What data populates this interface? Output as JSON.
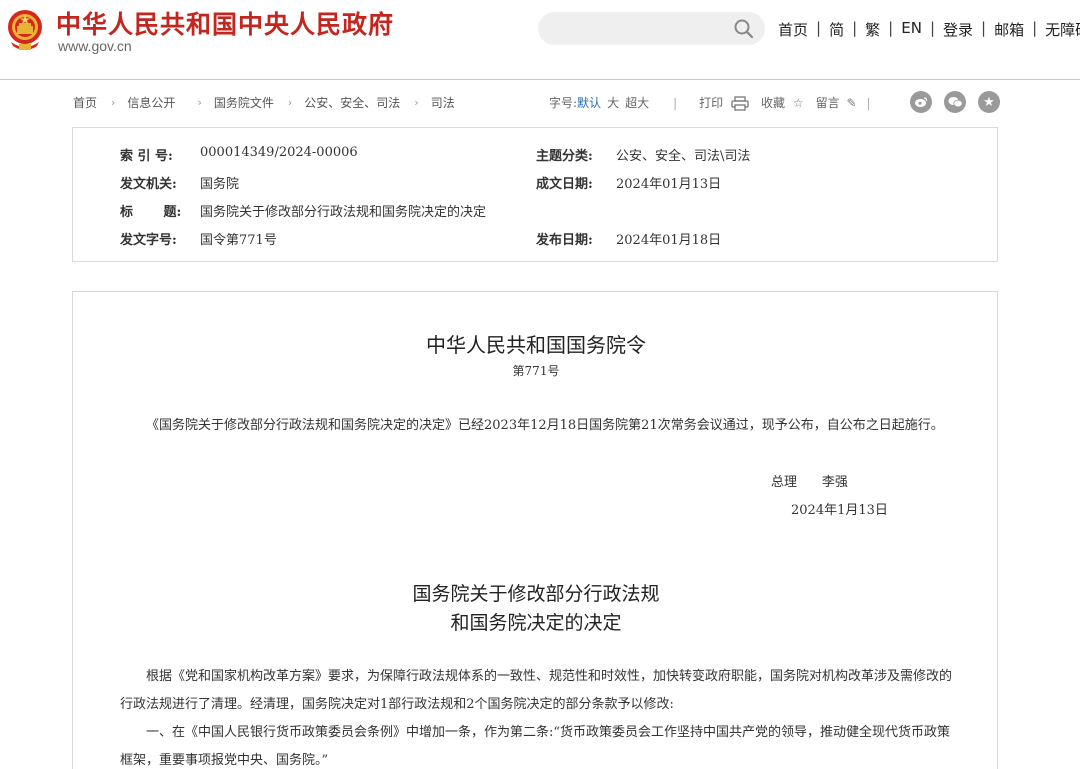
{
  "header": {
    "site_title": "中华人民共和国中央人民政府",
    "site_url": "www.gov.cn",
    "search_placeholder": "",
    "nav": [
      "首页",
      "简",
      "繁",
      "EN",
      "登录",
      "邮箱",
      "无障碍"
    ],
    "brand_color": "#c3261f"
  },
  "breadcrumb": [
    "首页",
    "信息公开",
    "国务院文件",
    "公安、安全、司法",
    "司法"
  ],
  "tools": {
    "font_size_label": "字号:",
    "font_default": "默认",
    "font_large": "大",
    "font_xlarge": "超大",
    "print": "打印",
    "favorite": "收藏",
    "comment": "留言"
  },
  "share_icons": [
    "weibo-icon",
    "wechat-icon",
    "favorite-icon"
  ],
  "info": {
    "index_label": "索 引 号:",
    "index_value": "000014349/2024-00006",
    "category_label": "主题分类:",
    "category_value": "公安、安全、司法\\司法",
    "issuer_label": "发文机关:",
    "issuer_value": "国务院",
    "created_label": "成文日期:",
    "created_value": "2024年01月13日",
    "title_label": "标 题:",
    "title_value": "国务院关于修改部分行政法规和国务院决定的决定",
    "docno_label": "发文字号:",
    "docno_value": "国令第771号",
    "published_label": "发布日期:",
    "published_value": "2024年01月18日"
  },
  "article": {
    "title": "中华人民共和国国务院令",
    "number": "第771号",
    "intro": "《国务院关于修改部分行政法规和国务院决定的决定》已经2023年12月18日国务院第21次常务会议通过，现予公布，自公布之日起施行。",
    "signer_title": "总理",
    "signer_name": "李强",
    "sign_date": "2024年1月13日",
    "decision_title_line1": "国务院关于修改部分行政法规",
    "decision_title_line2": "和国务院决定的决定",
    "para1": "根据《党和国家机构改革方案》要求，为保障行政法规体系的一致性、规范性和时效性，加快转变政府职能，国务院对机构改革涉及需修改的行政法规进行了清理。经清理，国务院决定对1部行政法规和2个国务院决定的部分条款予以修改:",
    "para2": "一、在《中国人民银行货币政策委员会条例》中增加一条，作为第二条:“货币政策委员会工作坚持中国共产党的领导，推动健全现代货币政策框架，重要事项报党中央、国务院。”"
  }
}
